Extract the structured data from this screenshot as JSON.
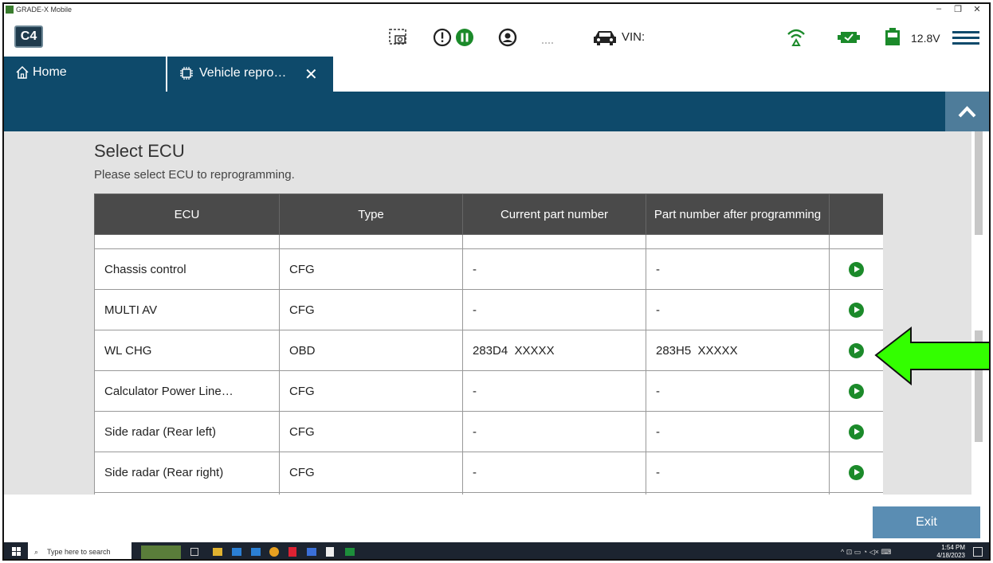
{
  "window": {
    "app_title": "GRADE-X Mobile",
    "minimize": "–",
    "maximize": "❐",
    "close": "✕"
  },
  "toolbar": {
    "logo_text": "C4",
    "vin_label": "VIN:",
    "voltage": "12.8V",
    "menu_icon": "hamburger-menu-icon"
  },
  "tabs": [
    {
      "label": "Home",
      "icon": "home-icon"
    },
    {
      "label": "Vehicle repro…",
      "icon": "chip-icon",
      "close": "✕"
    }
  ],
  "page": {
    "title": "Select ECU",
    "subtitle": "Please select ECU to reprogramming."
  },
  "table": {
    "headers": [
      "ECU",
      "Type",
      "Current part number",
      "Part number after programming"
    ],
    "rows": [
      {
        "ecu": "Chassis control",
        "type": "CFG",
        "current": "-",
        "after": "-"
      },
      {
        "ecu": "MULTI AV",
        "type": "CFG",
        "current": "-",
        "after": "-"
      },
      {
        "ecu": "WL CHG",
        "type": "OBD",
        "current": "283D4 XXXXX",
        "after": "283H5 XXXXX"
      },
      {
        "ecu": "Calculator Power Line…",
        "type": "CFG",
        "current": "-",
        "after": "-"
      },
      {
        "ecu": "Side radar (Rear left)",
        "type": "CFG",
        "current": "-",
        "after": "-"
      },
      {
        "ecu": "Side radar (Rear right)",
        "type": "CFG",
        "current": "-",
        "after": "-"
      }
    ]
  },
  "footer": {
    "exit_label": "Exit"
  },
  "taskbar": {
    "search_placeholder": "Type here to search",
    "time": "1:54 PM",
    "date": "4/18/2023"
  },
  "colors": {
    "primary": "#0e4a6b",
    "accent_button": "#5a8db3",
    "play_green": "#1b8a2a",
    "arrow_green": "#33ff00"
  }
}
